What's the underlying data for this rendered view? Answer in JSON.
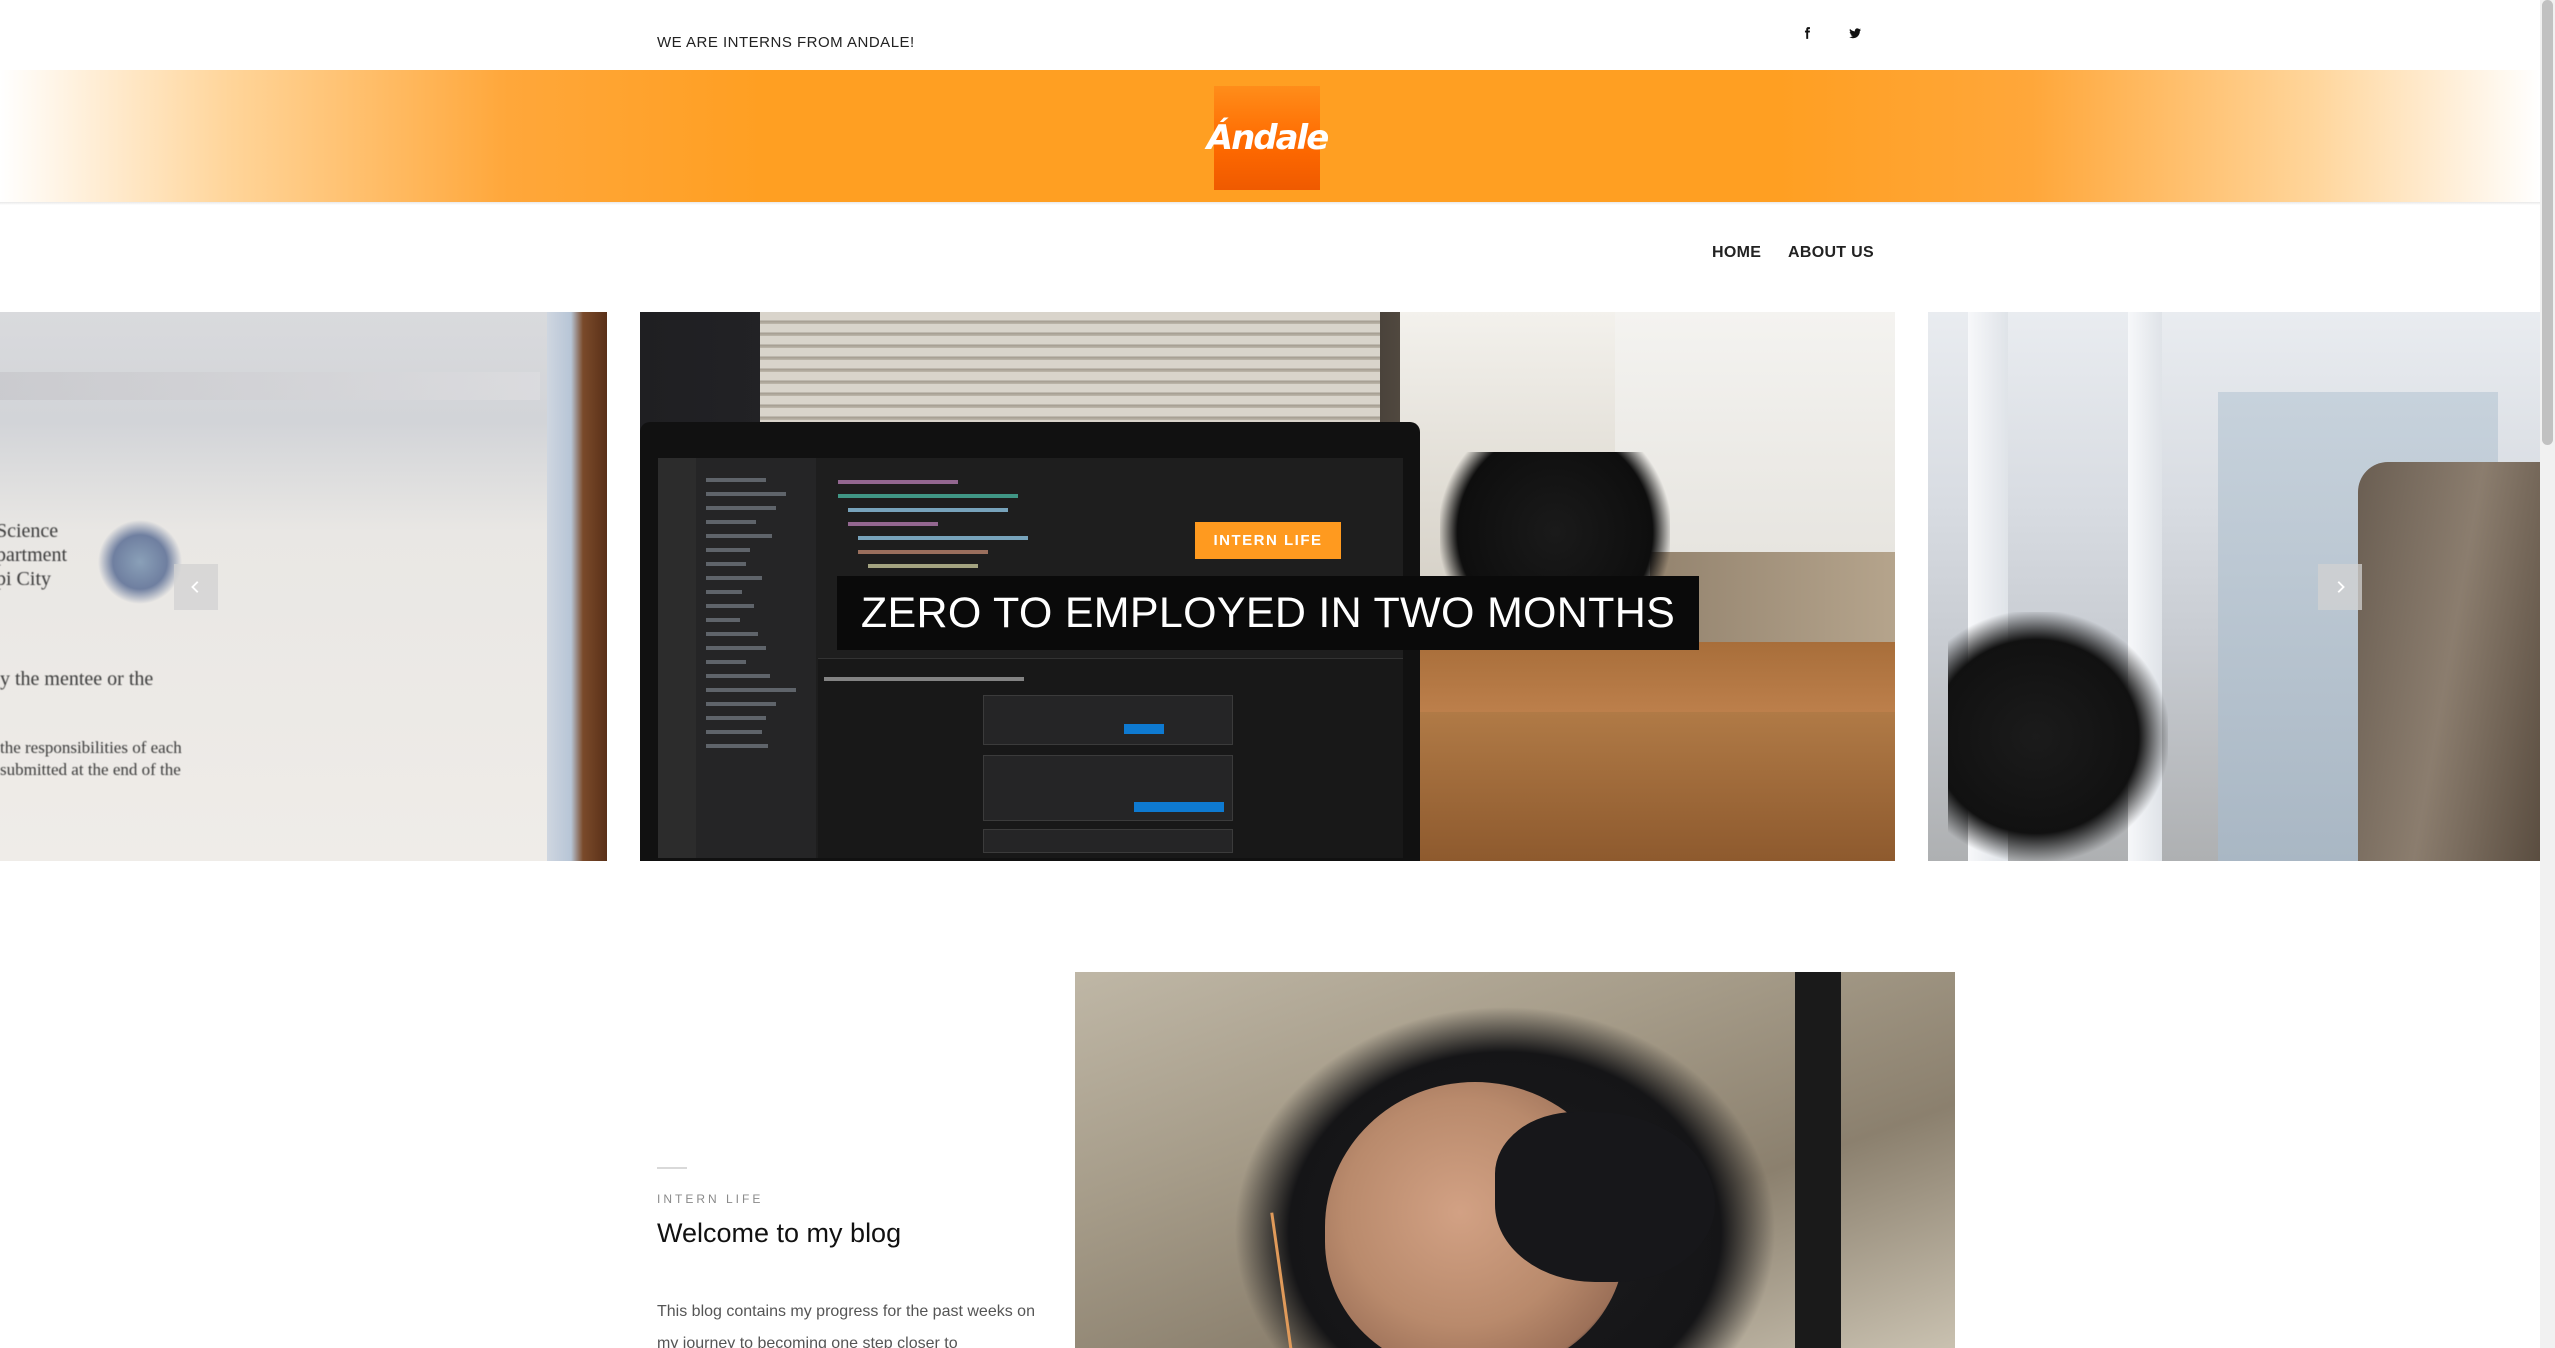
{
  "topbar": {
    "tagline": "WE ARE INTERNS FROM ANDALE!",
    "social": [
      {
        "icon": "facebook-icon"
      },
      {
        "icon": "twitter-icon"
      }
    ]
  },
  "header": {
    "logo_text": "Ándale",
    "colors": {
      "band": "#ff9f22",
      "logo": "#ff6a00"
    }
  },
  "nav": {
    "items": [
      {
        "label": "HOME"
      },
      {
        "label": "ABOUT US"
      }
    ]
  },
  "carousel": {
    "active_slide": {
      "category": "INTERN LIFE",
      "title": "ZERO TO EMPLOYED IN TWO MONTHS"
    },
    "left_slide_text": [
      "Science",
      "partment",
      "pi City",
      "y the mentee or the",
      "the responsibilities of each",
      "submitted at the end of the"
    ],
    "prev_icon": "chevron-left-icon",
    "next_icon": "chevron-right-icon",
    "badge_color": "#ff9a1f"
  },
  "post": {
    "category": "INTERN LIFE",
    "title": "Welcome to my blog",
    "excerpt": "This blog contains my progress for the past weeks on my journey to becoming one step closer to"
  }
}
